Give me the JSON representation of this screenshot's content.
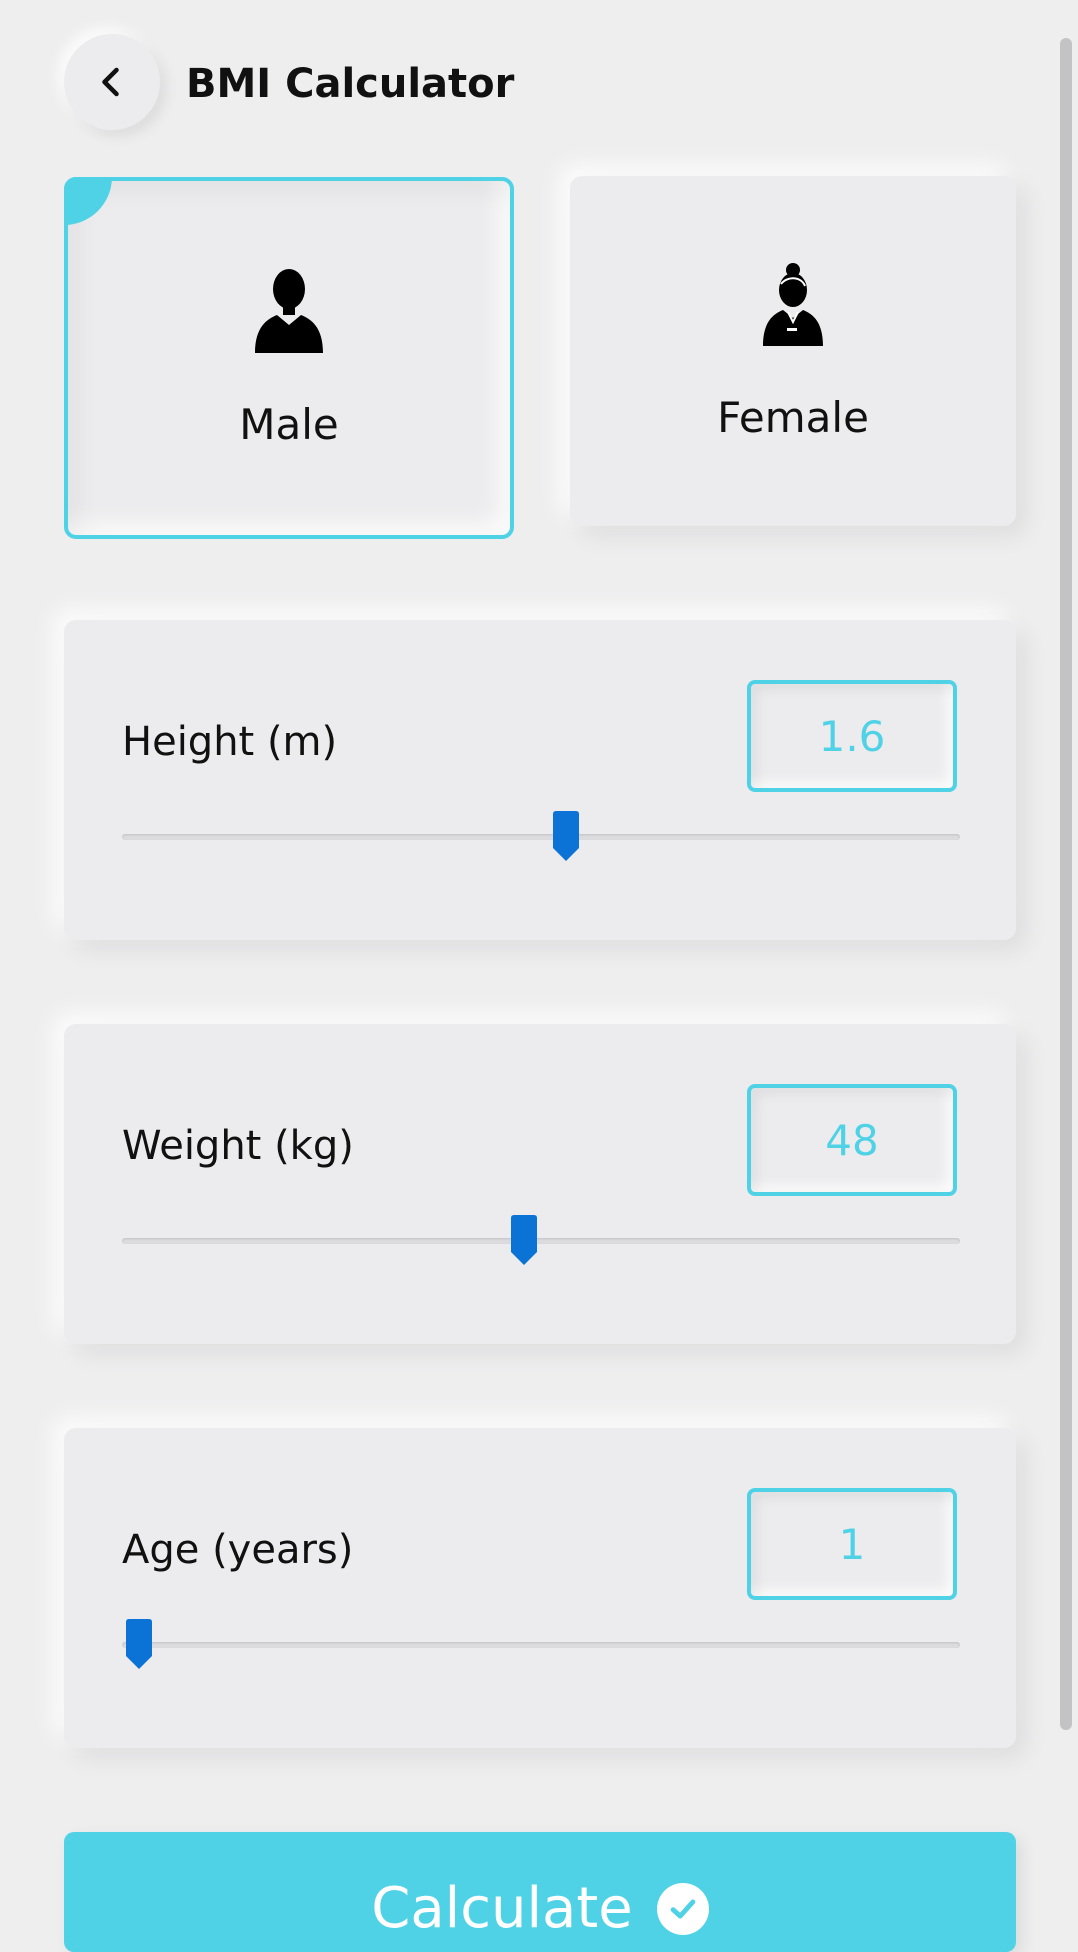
{
  "header": {
    "title": "BMI Calculator",
    "back_icon": "chevron-left-icon"
  },
  "gender": {
    "selected": "male",
    "options": [
      {
        "id": "male",
        "label": "Male",
        "icon": "male-user-icon"
      },
      {
        "id": "female",
        "label": "Female",
        "icon": "female-user-icon"
      }
    ]
  },
  "params": {
    "height": {
      "label": "Height (m)",
      "value": "1.6",
      "fraction": 0.53
    },
    "weight": {
      "label": "Weight (kg)",
      "value": "48",
      "fraction": 0.48
    },
    "age": {
      "label": "Age (years)",
      "value": "1",
      "fraction": 0.02
    }
  },
  "calculate": {
    "label": "Calculate",
    "icon": "check-circle-icon"
  },
  "colors": {
    "accent": "#4fd2e6",
    "slider_thumb": "#0b72d6",
    "background": "#eeeeef"
  }
}
